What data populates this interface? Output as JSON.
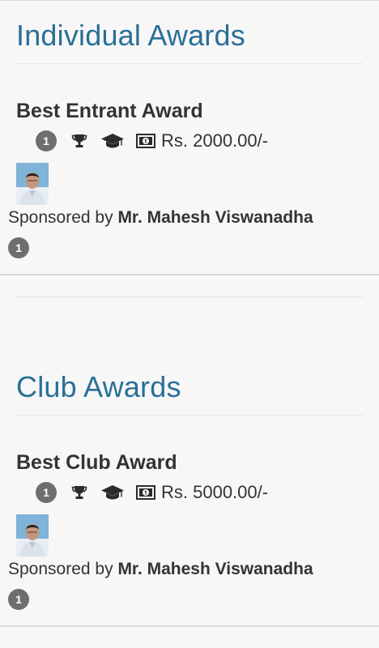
{
  "sections": [
    {
      "title": "Individual Awards",
      "award": {
        "name": "Best Entrant Award",
        "count": "1",
        "amount": "Rs. 2000.00/-",
        "sponsor_prefix": "Sponsored by ",
        "sponsor_name": "Mr. Mahesh Viswanadha",
        "sponsor_count": "1"
      }
    },
    {
      "title": "Club Awards",
      "award": {
        "name": "Best Club Award",
        "count": "1",
        "amount": "Rs. 5000.00/-",
        "sponsor_prefix": "Sponsored by ",
        "sponsor_name": "Mr. Mahesh Viswanadha",
        "sponsor_count": "1"
      }
    }
  ],
  "icons": {
    "count_badge": "count-badge",
    "trophy": "trophy-icon",
    "graduation": "graduation-cap-icon",
    "money": "money-icon",
    "avatar": "sponsor-avatar"
  },
  "colors": {
    "heading": "#2a6f97",
    "badge": "#6e6e6e",
    "text": "#333333",
    "background": "#f7f7f8"
  }
}
